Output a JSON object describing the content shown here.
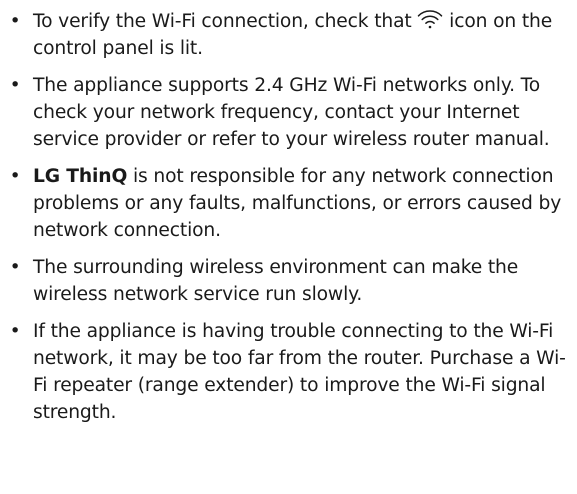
{
  "bullet_char": "•",
  "notes": [
    {
      "before_icon": "To verify the Wi-Fi connection, check that ",
      "icon": "wifi-icon",
      "after_icon": " icon on the control panel is lit."
    },
    {
      "text": "The appliance supports 2.4 GHz Wi-Fi networks only. To check your network frequency, contact your Internet service provider or refer to your wireless router manual."
    },
    {
      "bold": "LG ThinQ",
      "text": " is not responsible for any network connection problems or any faults, malfunctions, or errors caused by network connection."
    },
    {
      "text": "The surrounding wireless environment can make the wireless network service run slowly."
    },
    {
      "text": "If the appliance is having trouble connecting to the Wi-Fi network, it may be too far from the router. Purchase a Wi-Fi repeater (range extender) to improve the Wi-Fi signal strength."
    }
  ]
}
